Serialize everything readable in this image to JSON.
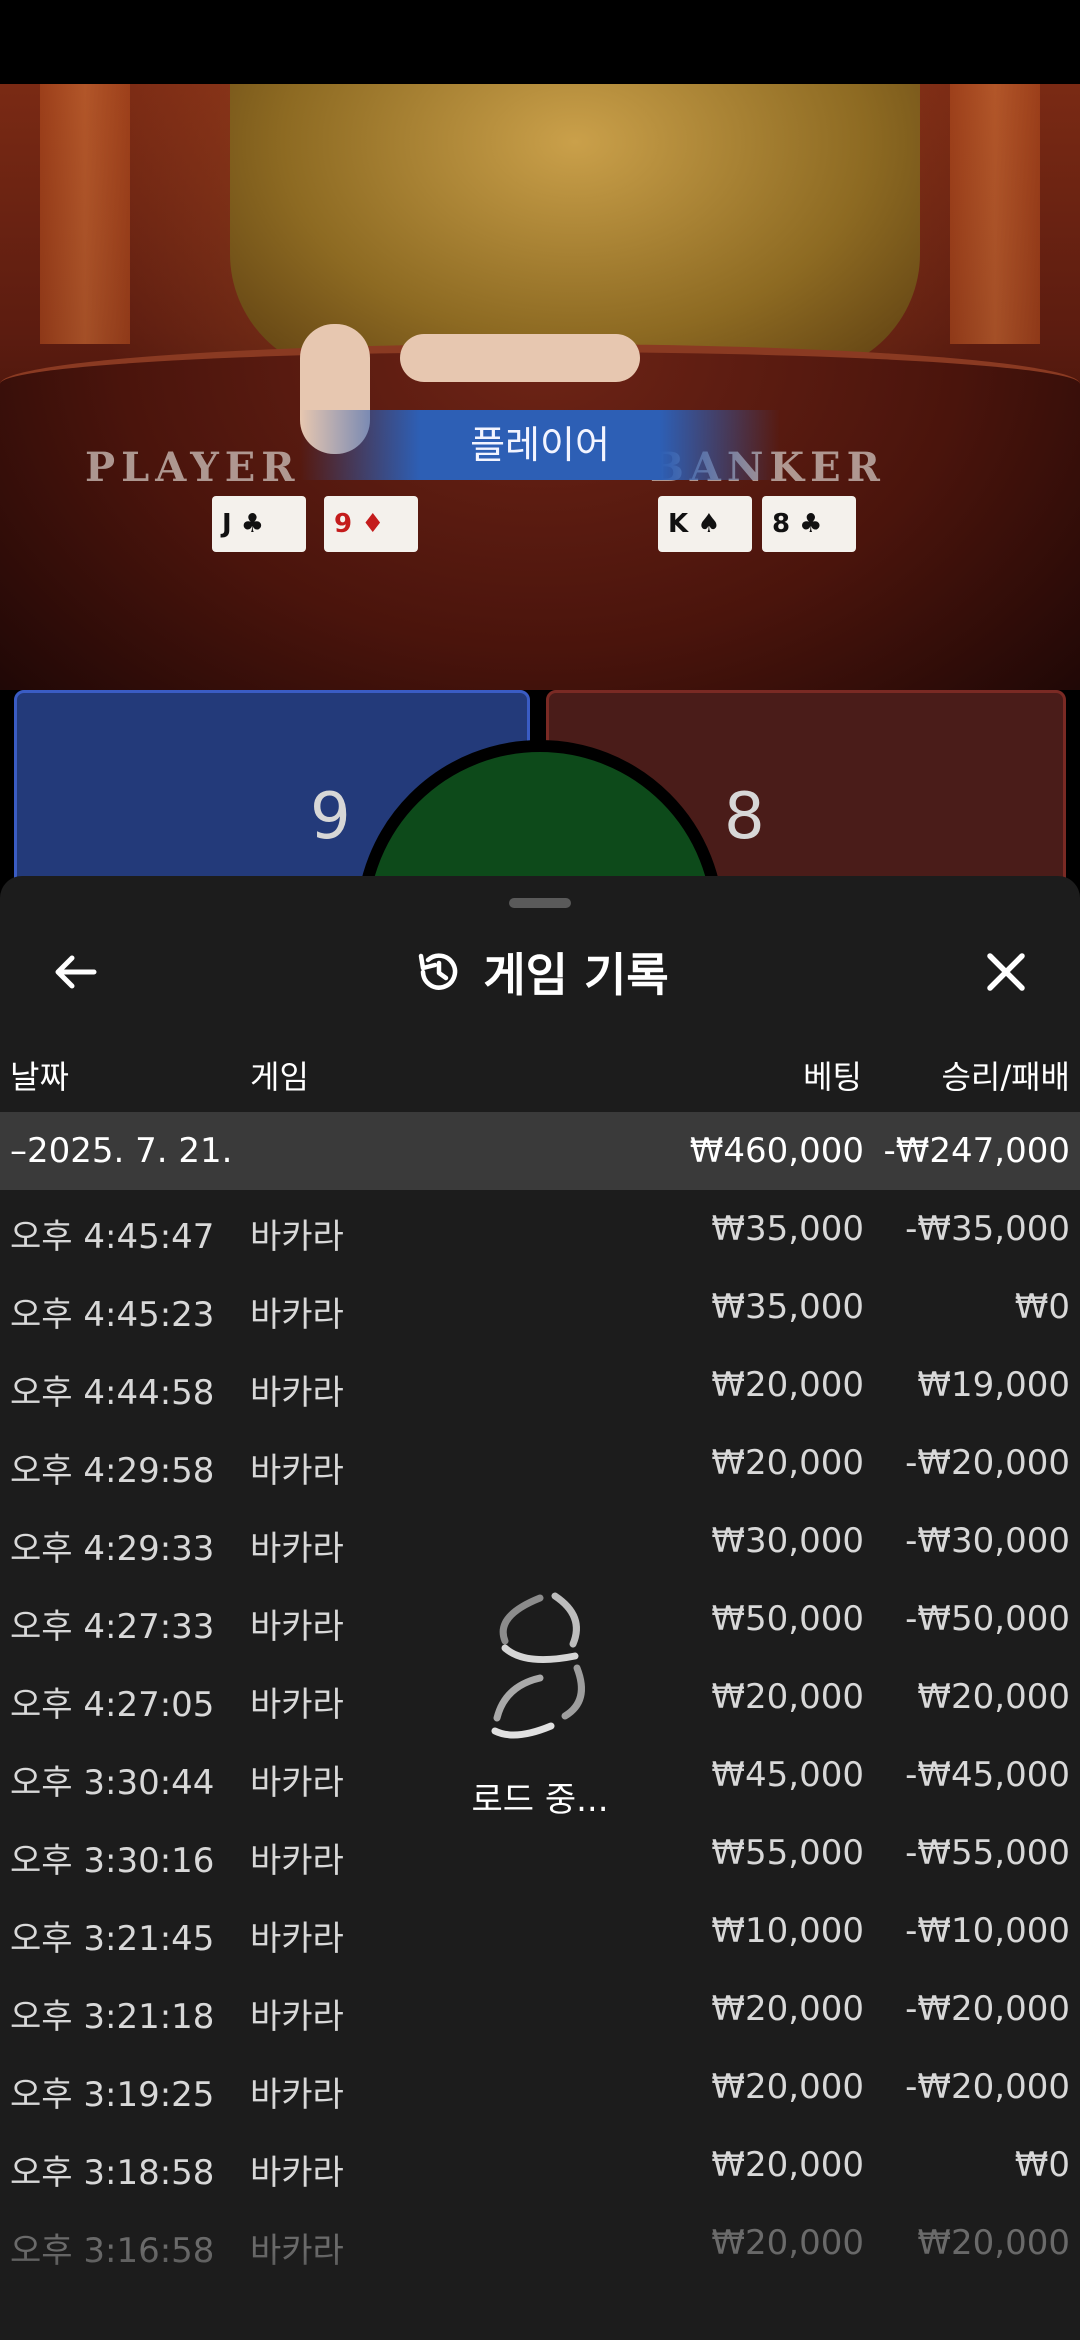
{
  "video": {
    "result_banner": "플레이어",
    "player_label": "PLAYER",
    "banker_label": "BANKER",
    "player_cards": [
      {
        "rank": "J",
        "suit": "♣",
        "red": false
      },
      {
        "rank": "9",
        "suit": "♦",
        "red": true
      }
    ],
    "banker_cards": [
      {
        "rank": "K",
        "suit": "♠",
        "red": false
      },
      {
        "rank": "8",
        "suit": "♣",
        "red": false
      }
    ]
  },
  "score": {
    "player": "9",
    "banker": "8"
  },
  "sheet": {
    "title": "게임 기록",
    "icons": {
      "back": "arrow-left-icon",
      "history": "history-icon",
      "close": "close-icon"
    },
    "columns": {
      "date": "날짜",
      "game": "게임",
      "bet": "베팅",
      "win": "승리/패배"
    },
    "date_group": {
      "date": "–2025. 7. 21.",
      "bet": "₩460,000",
      "win": "-₩247,000"
    },
    "rows": [
      {
        "time": "오후 4:45:47",
        "game": "바카라",
        "bet": "₩35,000",
        "win": "-₩35,000"
      },
      {
        "time": "오후 4:45:23",
        "game": "바카라",
        "bet": "₩35,000",
        "win": "₩0"
      },
      {
        "time": "오후 4:44:58",
        "game": "바카라",
        "bet": "₩20,000",
        "win": "₩19,000"
      },
      {
        "time": "오후 4:29:58",
        "game": "바카라",
        "bet": "₩20,000",
        "win": "-₩20,000"
      },
      {
        "time": "오후 4:29:33",
        "game": "바카라",
        "bet": "₩30,000",
        "win": "-₩30,000"
      },
      {
        "time": "오후 4:27:33",
        "game": "바카라",
        "bet": "₩50,000",
        "win": "-₩50,000"
      },
      {
        "time": "오후 4:27:05",
        "game": "바카라",
        "bet": "₩20,000",
        "win": "₩20,000"
      },
      {
        "time": "오후 3:30:44",
        "game": "바카라",
        "bet": "₩45,000",
        "win": "-₩45,000"
      },
      {
        "time": "오후 3:30:16",
        "game": "바카라",
        "bet": "₩55,000",
        "win": "-₩55,000"
      },
      {
        "time": "오후 3:21:45",
        "game": "바카라",
        "bet": "₩10,000",
        "win": "-₩10,000"
      },
      {
        "time": "오후 3:21:18",
        "game": "바카라",
        "bet": "₩20,000",
        "win": "-₩20,000"
      },
      {
        "time": "오후 3:19:25",
        "game": "바카라",
        "bet": "₩20,000",
        "win": "-₩20,000"
      },
      {
        "time": "오후 3:18:58",
        "game": "바카라",
        "bet": "₩20,000",
        "win": "₩0"
      },
      {
        "time": "오후 3:16:58",
        "game": "바카라",
        "bet": "₩20,000",
        "win": "₩20,000"
      }
    ],
    "loading_text": "로드 중..."
  }
}
